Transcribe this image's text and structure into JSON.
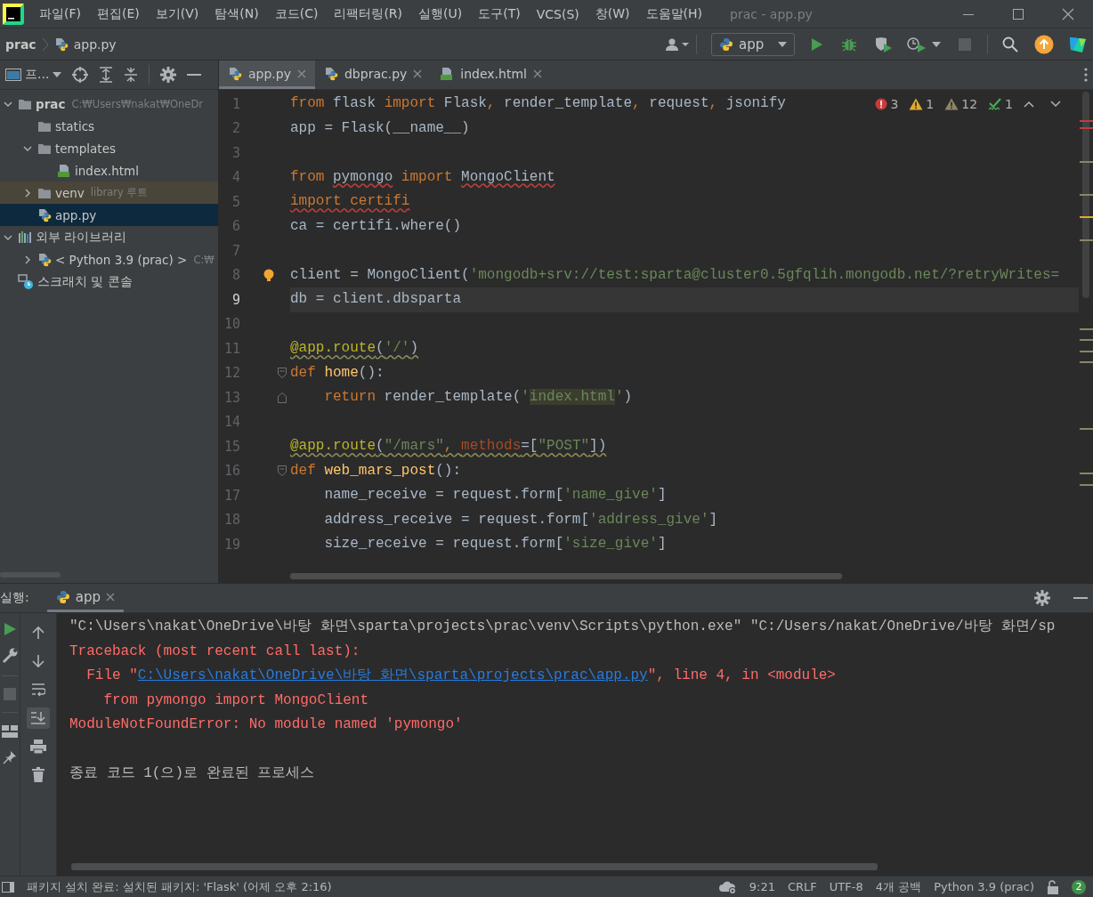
{
  "menu_bar": {
    "items": [
      "파일(F)",
      "편집(E)",
      "보기(V)",
      "탐색(N)",
      "코드(C)",
      "리팩터링(R)",
      "실행(U)",
      "도구(T)",
      "VCS(S)",
      "창(W)",
      "도움말(H)"
    ],
    "title": "prac - app.py"
  },
  "nav_bar": {
    "breadcrumbs": [
      "prac",
      "app.py"
    ],
    "run_config": "app"
  },
  "project_panel": {
    "title": "프...",
    "tree": [
      {
        "label": "prac",
        "kind": "folder",
        "hint": "C:₩Users₩nakat₩OneDr",
        "expanded": true,
        "selected": false,
        "highlighted": false,
        "children": [
          {
            "label": "statics",
            "kind": "folder",
            "selected": false,
            "highlighted": false
          },
          {
            "label": "templates",
            "kind": "folder",
            "expanded": true,
            "selected": false,
            "highlighted": false,
            "children": [
              {
                "label": "index.html",
                "kind": "html",
                "selected": false,
                "highlighted": false
              }
            ]
          },
          {
            "label": "venv",
            "kind": "folder",
            "hint": "library 루트",
            "expanded": false,
            "selected": false,
            "highlighted": true
          },
          {
            "label": "app.py",
            "kind": "python",
            "selected": true,
            "highlighted": false
          }
        ]
      },
      {
        "label": "외부 라이브러리",
        "kind": "libraries",
        "expanded": true,
        "selected": false,
        "highlighted": false,
        "children": [
          {
            "label": "< Python 3.9 (prac) >",
            "kind": "python",
            "hint": "C:₩",
            "expanded": false,
            "selected": false,
            "highlighted": false
          }
        ]
      },
      {
        "label": "스크래치 및 콘솔",
        "kind": "scratch",
        "selected": false,
        "highlighted": false
      }
    ]
  },
  "editor": {
    "tabs": [
      {
        "label": "app.py",
        "kind": "python",
        "selected": true
      },
      {
        "label": "dbprac.py",
        "kind": "python",
        "selected": false
      },
      {
        "label": "index.html",
        "kind": "html",
        "selected": false
      }
    ],
    "inspections": [
      {
        "kind": "error",
        "count": "3"
      },
      {
        "kind": "warning",
        "count": "1"
      },
      {
        "kind": "weak_warning",
        "count": "12"
      },
      {
        "kind": "typo",
        "count": "1"
      }
    ],
    "lines": [
      {
        "num": "1",
        "current": false,
        "tokens": [
          {
            "kind": "kw",
            "text": "from"
          },
          {
            "kind": "plain",
            "text": " flask "
          },
          {
            "kind": "kw",
            "text": "import"
          },
          {
            "kind": "plain",
            "text": " Flask"
          },
          {
            "kind": "kw",
            "text": ", "
          },
          {
            "kind": "plain",
            "text": "render_template"
          },
          {
            "kind": "kw",
            "text": ", "
          },
          {
            "kind": "plain",
            "text": "request"
          },
          {
            "kind": "kw",
            "text": ", "
          },
          {
            "kind": "plain",
            "text": "jsonify"
          }
        ]
      },
      {
        "num": "2",
        "current": false,
        "tokens": [
          {
            "kind": "plain",
            "text": "app = Flask(__name__)"
          }
        ]
      },
      {
        "num": "3",
        "current": false
      },
      {
        "num": "4",
        "current": false,
        "tokens": [
          {
            "kind": "kw",
            "text": "from "
          },
          {
            "kind": "plain",
            "text": "pymongo",
            "error": true
          },
          {
            "kind": "kw",
            "text": " import "
          },
          {
            "kind": "plain",
            "text": "MongoClient",
            "error": true
          }
        ]
      },
      {
        "num": "5",
        "current": false,
        "tokens": [
          {
            "kind": "kw",
            "text": "import certifi",
            "error": true
          }
        ]
      },
      {
        "num": "6",
        "current": false,
        "tokens": [
          {
            "kind": "plain",
            "text": "ca = certifi.where()"
          }
        ]
      },
      {
        "num": "7",
        "current": false
      },
      {
        "num": "8",
        "current": false,
        "bulb": true,
        "tokens": [
          {
            "kind": "plain",
            "text": "client = MongoClient("
          },
          {
            "kind": "str",
            "text": "'mongodb+srv://test:sparta@cluster0.5gfqlih.mongodb.net/?retryWrites="
          }
        ]
      },
      {
        "num": "9",
        "current": true,
        "tokens": [
          {
            "kind": "plain",
            "text": "db = client.dbsparta"
          }
        ]
      },
      {
        "num": "10",
        "current": false
      },
      {
        "num": "11",
        "current": false,
        "tokens": [
          {
            "kind": "deco",
            "text": "@app.route",
            "warning": true
          },
          {
            "kind": "plain",
            "text": "(",
            "warning": true
          },
          {
            "kind": "str",
            "text": "'/'",
            "warning": true
          },
          {
            "kind": "plain",
            "text": ")",
            "warning": true
          }
        ]
      },
      {
        "num": "12",
        "current": false,
        "fold_start": true,
        "tokens": [
          {
            "kind": "kw",
            "text": "def "
          },
          {
            "kind": "fn",
            "text": "home"
          },
          {
            "kind": "plain",
            "text": "():"
          }
        ]
      },
      {
        "num": "13",
        "current": false,
        "fold_end": true,
        "tokens": [
          {
            "kind": "kw",
            "text": "    return"
          },
          {
            "kind": "plain",
            "text": " render_template("
          },
          {
            "kind": "str",
            "text": "'"
          },
          {
            "kind": "str",
            "text": "index.html",
            "highlighted": true
          },
          {
            "kind": "str",
            "text": "'"
          },
          {
            "kind": "plain",
            "text": ")"
          }
        ]
      },
      {
        "num": "14",
        "current": false
      },
      {
        "num": "15",
        "current": false,
        "tokens": [
          {
            "kind": "deco",
            "text": "@app.route",
            "warning": true
          },
          {
            "kind": "plain",
            "text": "(",
            "warning": true
          },
          {
            "kind": "str",
            "text": "\"/mars\"",
            "warning": true
          },
          {
            "kind": "kw",
            "text": ", ",
            "warning": true
          },
          {
            "kind": "kwarg",
            "text": "methods",
            "warning": true
          },
          {
            "kind": "plain",
            "text": "=[",
            "warning": true
          },
          {
            "kind": "str",
            "text": "\"POST\"",
            "warning": true
          },
          {
            "kind": "plain",
            "text": "])",
            "warning": true
          }
        ]
      },
      {
        "num": "16",
        "current": false,
        "fold_start": true,
        "tokens": [
          {
            "kind": "kw",
            "text": "def "
          },
          {
            "kind": "fn",
            "text": "web_mars_post"
          },
          {
            "kind": "plain",
            "text": "():"
          }
        ]
      },
      {
        "num": "17",
        "current": false,
        "tokens": [
          {
            "kind": "plain",
            "text": "    name_receive = request.form["
          },
          {
            "kind": "str",
            "text": "'name_give'"
          },
          {
            "kind": "plain",
            "text": "]"
          }
        ]
      },
      {
        "num": "18",
        "current": false,
        "tokens": [
          {
            "kind": "plain",
            "text": "    address_receive = request.form["
          },
          {
            "kind": "str",
            "text": "'address_give'"
          },
          {
            "kind": "plain",
            "text": "]"
          }
        ]
      },
      {
        "num": "19",
        "current": false,
        "tokens": [
          {
            "kind": "plain",
            "text": "    size_receive = request.form["
          },
          {
            "kind": "str",
            "text": "'size_give'"
          },
          {
            "kind": "plain",
            "text": "]"
          }
        ]
      }
    ]
  },
  "run_panel": {
    "title": "실행:",
    "tab": "app",
    "soft_wrap": false,
    "scroll_to_end": true,
    "output": [
      {
        "kind": "stream",
        "segments": [
          {
            "kind": "plain",
            "text": "\"C:\\Users\\nakat\\OneDrive\\바탕 화면\\sparta\\projects\\prac\\venv\\Scripts\\python.exe\" \"C:/Users/nakat/OneDrive/바탕 화면/sp"
          }
        ]
      },
      {
        "kind": "stream",
        "segments": [
          {
            "kind": "error",
            "text": "Traceback (most recent call last):"
          }
        ]
      },
      {
        "kind": "stream",
        "segments": [
          {
            "kind": "error",
            "text": "  File \""
          },
          {
            "kind": "link",
            "text": "C:\\Users\\nakat\\OneDrive\\바탕 화면\\sparta\\projects\\prac\\app.py"
          },
          {
            "kind": "error",
            "text": "\", line 4, in <module>"
          }
        ]
      },
      {
        "kind": "stream",
        "segments": [
          {
            "kind": "error",
            "text": "    from pymongo import MongoClient"
          }
        ]
      },
      {
        "kind": "stream",
        "segments": [
          {
            "kind": "error",
            "text": "ModuleNotFoundError: No module named 'pymongo'"
          }
        ]
      },
      {
        "kind": "exit",
        "segments": [
          {
            "kind": "plain",
            "text": "종료 코드 1(으)로 완료된 프로세스"
          }
        ]
      }
    ]
  },
  "status_bar": {
    "message": "패키지 설치 완료: 설치된 패키지: 'Flask' (어제 오후 2:16)",
    "items": [
      "9:21",
      "CRLF",
      "UTF-8",
      "4개 공백",
      "Python 3.9 (prac)"
    ],
    "notifications": "2"
  }
}
